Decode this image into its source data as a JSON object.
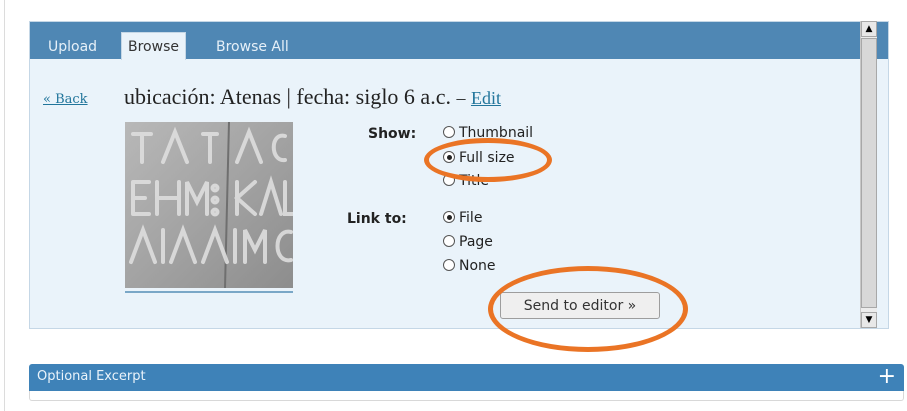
{
  "tabs": [
    {
      "label": "Upload",
      "active": false
    },
    {
      "label": "Browse",
      "active": true
    },
    {
      "label": "Browse All",
      "active": false
    }
  ],
  "back_label": "« Back",
  "media": {
    "title": "ubicación: Atenas | fecha: siglo 6 a.c.",
    "separator": "–",
    "edit_label": "Edit",
    "thumbnail_icon": "inscription-stone-thumbnail"
  },
  "show": {
    "label": "Show:",
    "options": [
      {
        "label": "Thumbnail",
        "checked": false
      },
      {
        "label": "Full size",
        "checked": true
      },
      {
        "label": "Title",
        "checked": false
      }
    ]
  },
  "link_to": {
    "label": "Link to:",
    "options": [
      {
        "label": "File",
        "checked": true
      },
      {
        "label": "Page",
        "checked": false
      },
      {
        "label": "None",
        "checked": false
      }
    ]
  },
  "send_button_label": "Send to editor »",
  "excerpt": {
    "title": "Optional Excerpt",
    "toggle_icon": "plus-icon"
  },
  "colors": {
    "tab_bar": "#4f87b4",
    "panel": "#eaf3fa",
    "highlight": "#ea7425",
    "link": "#21759b"
  }
}
